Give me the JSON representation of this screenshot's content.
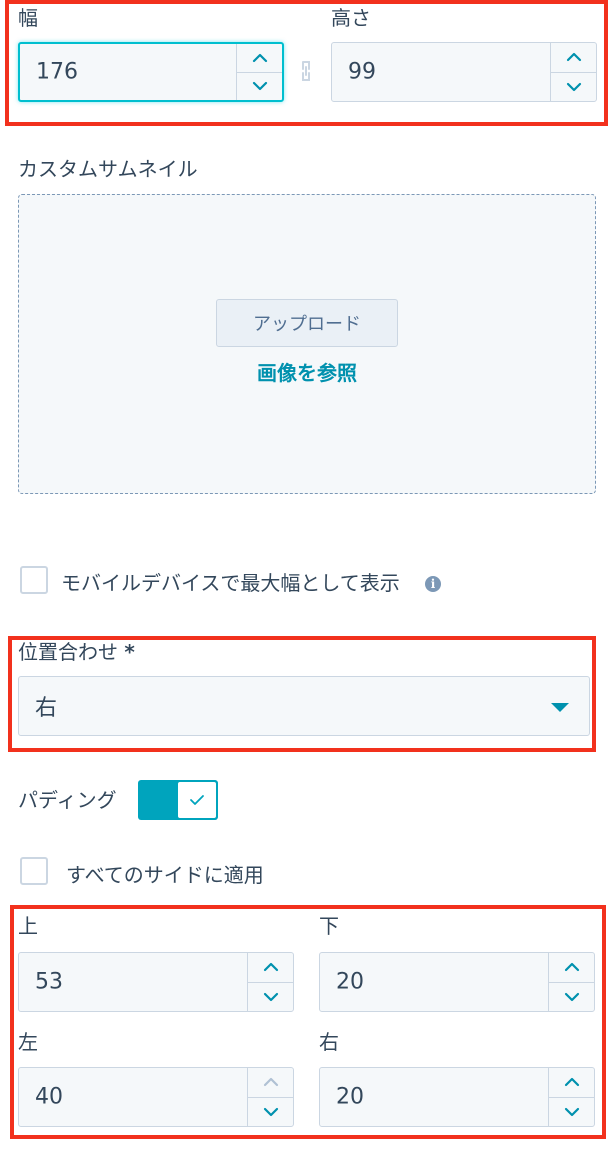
{
  "dimensions": {
    "width_label": "幅",
    "width_value": "176",
    "height_label": "高さ",
    "height_value": "99"
  },
  "thumbnail": {
    "label": "カスタムサムネイル",
    "upload_label": "アップロード",
    "browse_label": "画像を参照"
  },
  "mobile": {
    "label": "モバイルデバイスで最大幅として表示",
    "checked": false
  },
  "alignment": {
    "label": "位置合わせ",
    "required_mark": "*",
    "selected": "右"
  },
  "padding": {
    "label": "パディング",
    "enabled": true,
    "apply_all_label": "すべてのサイドに適用",
    "apply_all_checked": false,
    "top_label": "上",
    "top_value": "53",
    "bottom_label": "下",
    "bottom_value": "20",
    "left_label": "左",
    "left_value": "40",
    "right_label": "右",
    "right_value": "20"
  },
  "colors": {
    "accent": "#0091ae",
    "toggle": "#00a4bd",
    "highlight": "#f2311d",
    "field_bg": "#f5f8fa",
    "border": "#cbd6e2"
  }
}
